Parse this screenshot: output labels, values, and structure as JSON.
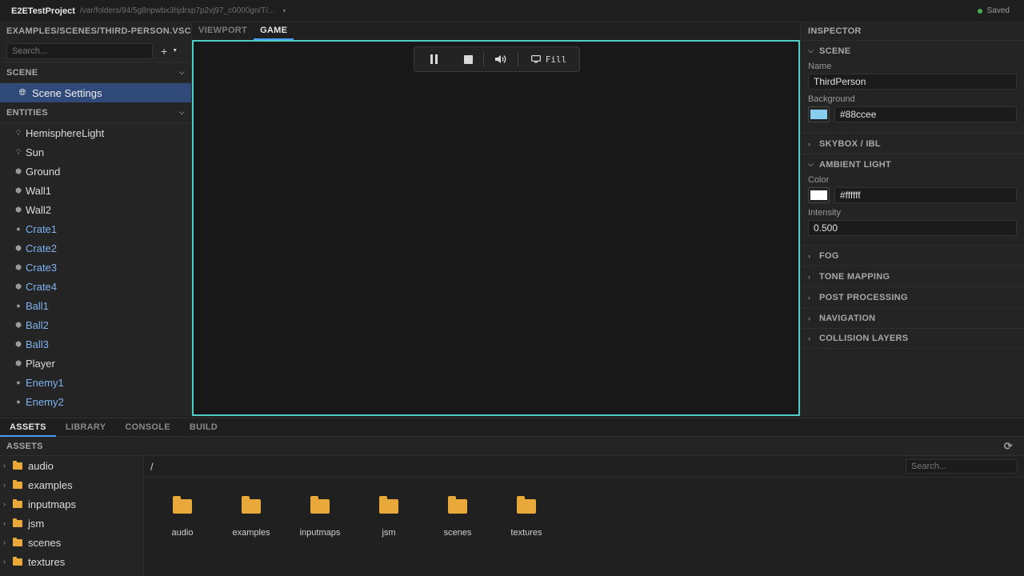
{
  "titlebar": {
    "project": "E2ETestProject",
    "path": "/var/folders/94/5g8npwbx3hjdrxp7p2vj97_c0000gn/T/...",
    "status": "Saved",
    "status_color": "#4caf50"
  },
  "left": {
    "scene_path": "EXAMPLES/SCENES/THIRD-PERSON.VSCN",
    "search_placeholder": "Search...",
    "scene_section": "SCENE",
    "scene_settings": "Scene Settings",
    "entities_section": "ENTITIES",
    "entities": [
      {
        "name": "HemisphereLight",
        "icon": "light-icon",
        "color": "default"
      },
      {
        "name": "Sun",
        "icon": "light-icon",
        "color": "default"
      },
      {
        "name": "Ground",
        "icon": "mesh-icon",
        "color": "default"
      },
      {
        "name": "Wall1",
        "icon": "mesh-icon",
        "color": "default"
      },
      {
        "name": "Wall2",
        "icon": "mesh-icon",
        "color": "default"
      },
      {
        "name": "Crate1",
        "icon": "body-icon",
        "color": "blue"
      },
      {
        "name": "Crate2",
        "icon": "mesh-icon",
        "color": "blue"
      },
      {
        "name": "Crate3",
        "icon": "mesh-icon",
        "color": "blue"
      },
      {
        "name": "Crate4",
        "icon": "mesh-icon",
        "color": "blue"
      },
      {
        "name": "Ball1",
        "icon": "body-icon",
        "color": "blue"
      },
      {
        "name": "Ball2",
        "icon": "mesh-icon",
        "color": "blue"
      },
      {
        "name": "Ball3",
        "icon": "mesh-icon",
        "color": "blue"
      },
      {
        "name": "Player",
        "icon": "mesh-icon",
        "color": "default"
      },
      {
        "name": "Enemy1",
        "icon": "body-icon",
        "color": "blue"
      },
      {
        "name": "Enemy2",
        "icon": "body-icon",
        "color": "blue"
      }
    ]
  },
  "center": {
    "tabs": [
      {
        "label": "VIEWPORT",
        "active": false
      },
      {
        "label": "GAME",
        "active": true
      }
    ],
    "fill_label": "Fill",
    "border_color": "#4ecdc4"
  },
  "inspector": {
    "title": "INSPECTOR",
    "scene_section": "SCENE",
    "name_label": "Name",
    "name_value": "ThirdPerson",
    "background_label": "Background",
    "background_value": "#88ccee",
    "skybox": "SKYBOX / IBL",
    "ambient_section": "AMBIENT LIGHT",
    "color_label": "Color",
    "color_value": "#ffffff",
    "intensity_label": "Intensity",
    "intensity_value": "0.500",
    "collapsed_sections": [
      "FOG",
      "TONE MAPPING",
      "POST PROCESSING",
      "NAVIGATION",
      "COLLISION LAYERS"
    ]
  },
  "bottom": {
    "tabs": [
      {
        "label": "ASSETS",
        "active": true
      },
      {
        "label": "LIBRARY",
        "active": false
      },
      {
        "label": "CONSOLE",
        "active": false
      },
      {
        "label": "BUILD",
        "active": false
      }
    ],
    "assets_header": "ASSETS",
    "path": "/",
    "search_placeholder": "Search...",
    "folders": [
      "audio",
      "examples",
      "inputmaps",
      "jsm",
      "scenes",
      "textures"
    ],
    "folder_color": "#e8a93a"
  }
}
